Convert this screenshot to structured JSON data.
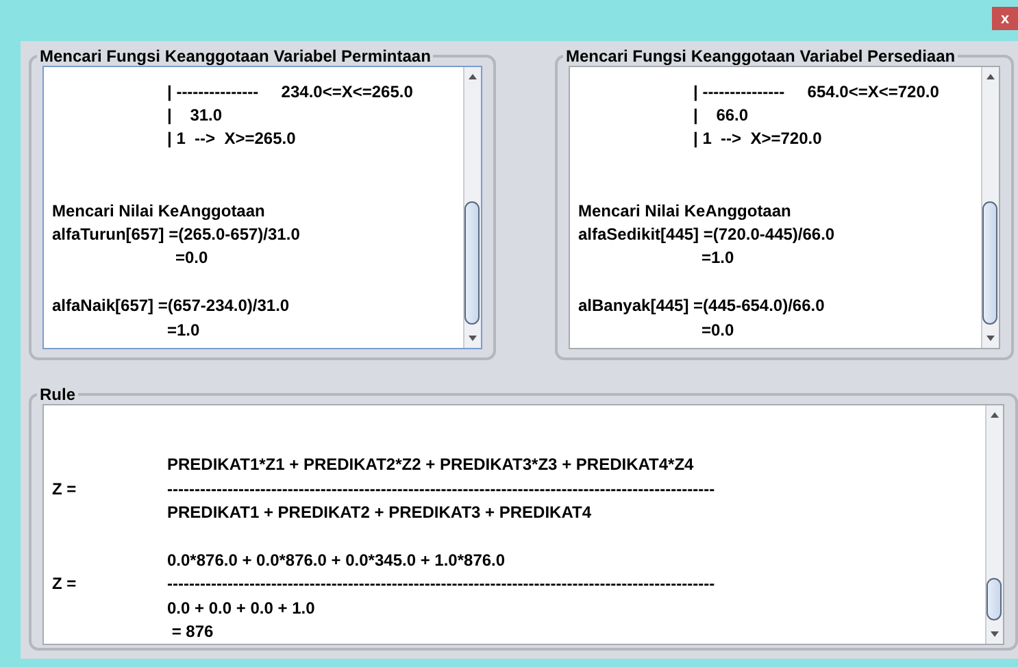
{
  "window": {
    "close": "x"
  },
  "panels": [
    {
      "title": "Mencari Fungsi Keanggotaan Variabel Permintaan",
      "focused": true,
      "lines": [
        {
          "kind": "value",
          "value": "| ---------------     234.0<=X<=265.0"
        },
        {
          "kind": "value",
          "value": "|    31.0"
        },
        {
          "kind": "value",
          "value": "| 1  -->  X>=265.0"
        },
        {
          "kind": "blank"
        },
        {
          "kind": "blank"
        },
        {
          "kind": "text",
          "text": "Mencari Nilai KeAnggotaan"
        },
        {
          "kind": "text",
          "text": "alfaTurun[657] =(265.0-657)/31.0"
        },
        {
          "kind": "result",
          "value": "=0.0"
        },
        {
          "kind": "blank"
        },
        {
          "kind": "text",
          "text": "alfaNaik[657] =(657-234.0)/31.0"
        },
        {
          "kind": "value",
          "value": "=1.0"
        }
      ]
    },
    {
      "title": "Mencari Fungsi Keanggotaan Variabel Persediaan",
      "focused": false,
      "lines": [
        {
          "kind": "value",
          "value": "| ---------------     654.0<=X<=720.0"
        },
        {
          "kind": "value",
          "value": "|    66.0"
        },
        {
          "kind": "value",
          "value": "| 1  -->  X>=720.0"
        },
        {
          "kind": "blank"
        },
        {
          "kind": "blank"
        },
        {
          "kind": "text",
          "text": "Mencari Nilai KeAnggotaan"
        },
        {
          "kind": "text",
          "text": "alfaSedikit[445] =(720.0-445)/66.0"
        },
        {
          "kind": "result",
          "value": "=1.0"
        },
        {
          "kind": "blank"
        },
        {
          "kind": "text",
          "text": "alBanyak[445] =(445-654.0)/66.0"
        },
        {
          "kind": "result",
          "value": "=0.0"
        }
      ]
    }
  ],
  "rule": {
    "title": "Rule",
    "focused": false,
    "lines": [
      {
        "kind": "blank"
      },
      {
        "kind": "blank"
      },
      {
        "kind": "value",
        "value": "PREDIKAT1*Z1 + PREDIKAT2*Z2 + PREDIKAT3*Z3 + PREDIKAT4*Z4"
      },
      {
        "kind": "pair",
        "label": "Z =",
        "value": "----------------------------------------------------------------------------------------------------"
      },
      {
        "kind": "value",
        "value": "PREDIKAT1 + PREDIKAT2 + PREDIKAT3 + PREDIKAT4"
      },
      {
        "kind": "blank"
      },
      {
        "kind": "value",
        "value": "0.0*876.0 + 0.0*876.0 + 0.0*345.0 + 1.0*876.0"
      },
      {
        "kind": "pair",
        "label": "Z =",
        "value": "----------------------------------------------------------------------------------------------------"
      },
      {
        "kind": "value",
        "value": "0.0 + 0.0 + 0.0 + 1.0"
      },
      {
        "kind": "value",
        "value": " = 876"
      }
    ]
  }
}
